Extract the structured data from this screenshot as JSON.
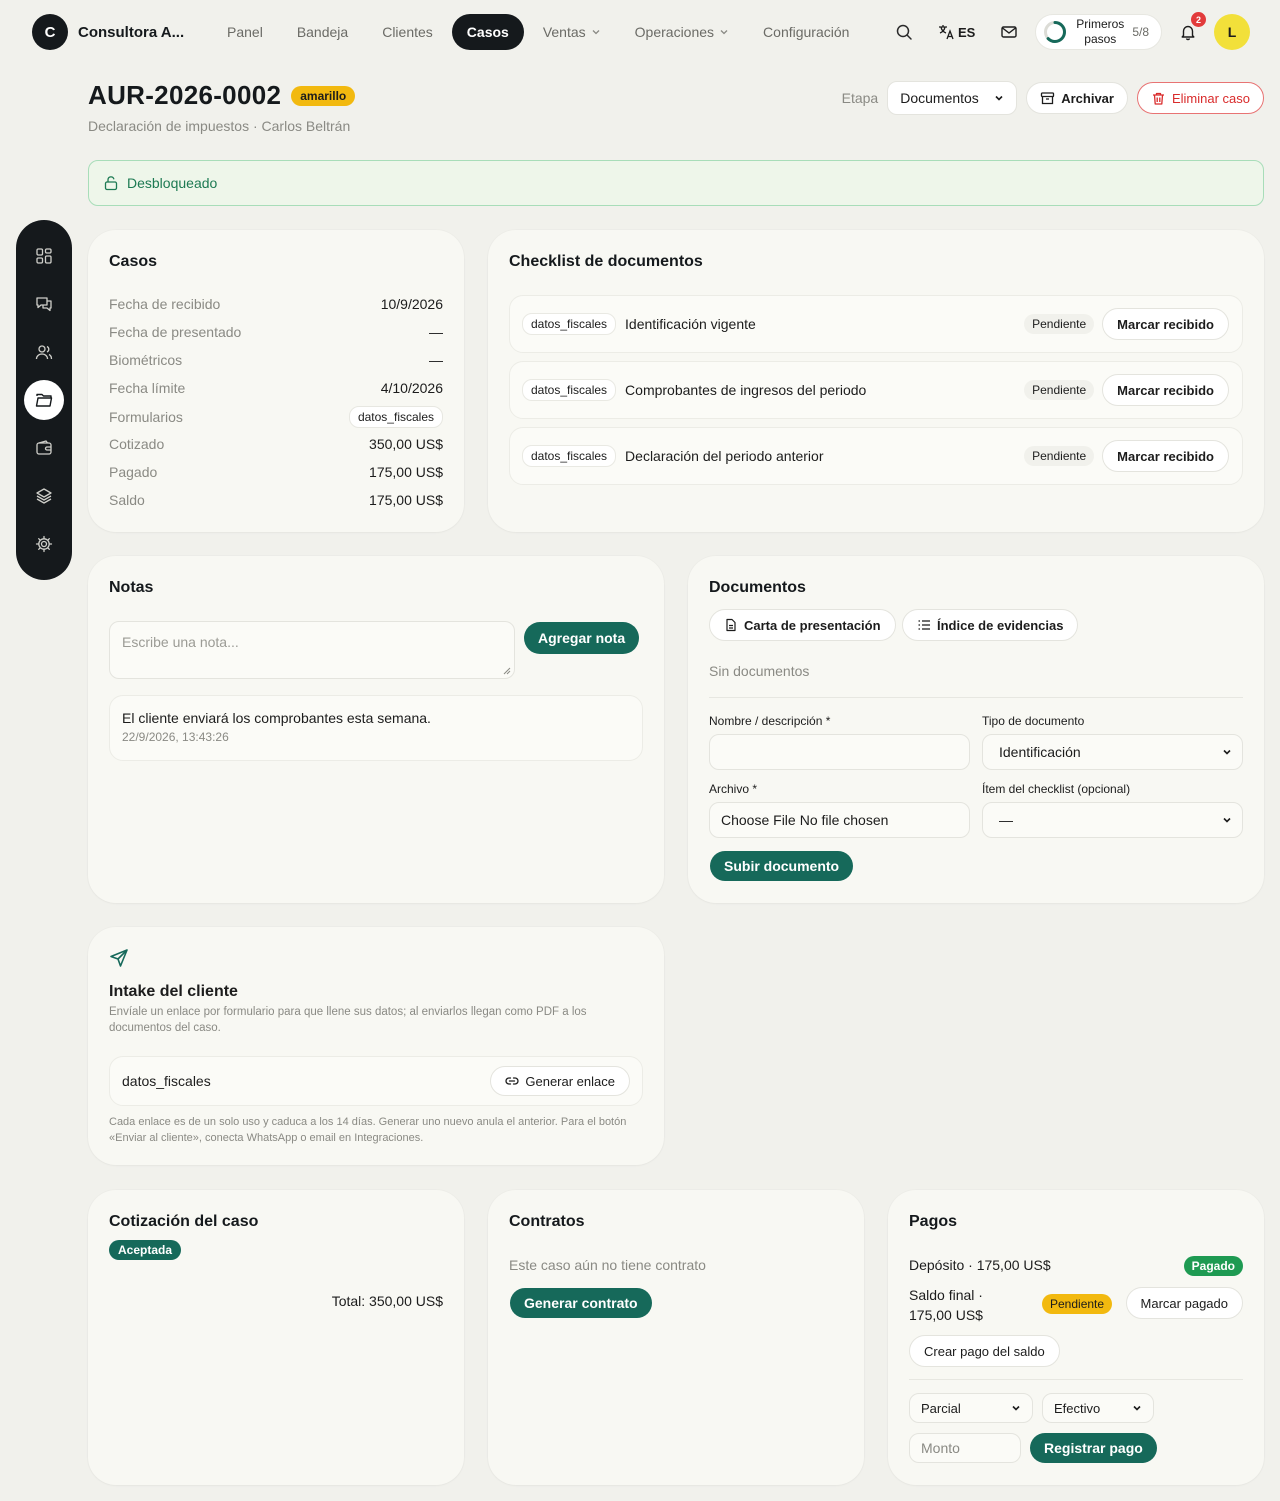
{
  "colors": {
    "accent": "#16695a",
    "dark": "#15191c",
    "danger": "#d92b2b",
    "unlocked": "#1d7a53",
    "tag_yellow": "#f2b90f",
    "paid": "#1e9a52"
  },
  "nav": {
    "brand_initial": "C",
    "brand_name": "Consultora A...",
    "links": [
      {
        "label": "Panel"
      },
      {
        "label": "Bandeja"
      },
      {
        "label": "Clientes"
      },
      {
        "label": "Casos",
        "active": true
      },
      {
        "label": "Ventas",
        "has_menu": true
      },
      {
        "label": "Operaciones",
        "has_menu": true
      },
      {
        "label": "Configuración"
      }
    ],
    "language": "ES",
    "onboarding_label_1": "Primeros",
    "onboarding_label_2": "pasos",
    "onboarding_count": "5/8",
    "onboarding_progress": 0.625,
    "notifications": "2",
    "avatar_initial": "L"
  },
  "rail": {
    "items": [
      "grid-icon",
      "chat-icon",
      "users-icon",
      "folder-icon",
      "wallet-icon",
      "layers-icon",
      "settings-icon"
    ],
    "active_index": 3
  },
  "header": {
    "case_id": "AUR-2026-0002",
    "color_tag": "amarillo",
    "subtitle": "Declaración de impuestos · Carlos Beltrán",
    "stage_label": "Etapa",
    "stage_value": "Documentos",
    "archive_label": "Archivar",
    "delete_label": "Eliminar caso"
  },
  "lock_status": "Desbloqueado",
  "casos": {
    "title": "Casos",
    "rows": [
      {
        "k": "Fecha de recibido",
        "v": "10/9/2026"
      },
      {
        "k": "Fecha de presentado",
        "v": "—"
      },
      {
        "k": "Biométricos",
        "v": "—"
      },
      {
        "k": "Fecha límite",
        "v": "4/10/2026"
      },
      {
        "k": "Formularios",
        "v": "datos_fiscales",
        "chip": true
      },
      {
        "k": "Cotizado",
        "v": "350,00 US$"
      },
      {
        "k": "Pagado",
        "v": "175,00 US$"
      },
      {
        "k": "Saldo",
        "v": "175,00 US$"
      }
    ]
  },
  "checklist": {
    "title": "Checklist de documentos",
    "items": [
      {
        "tag": "datos_fiscales",
        "doc": "Identificación vigente",
        "status": "Pendiente",
        "action": "Marcar recibido"
      },
      {
        "tag": "datos_fiscales",
        "doc": "Comprobantes de ingresos del periodo",
        "status": "Pendiente",
        "action": "Marcar recibido"
      },
      {
        "tag": "datos_fiscales",
        "doc": "Declaración del periodo anterior",
        "status": "Pendiente",
        "action": "Marcar recibido"
      }
    ]
  },
  "notes": {
    "title": "Notas",
    "placeholder": "Escribe una nota...",
    "add_label": "Agregar nota",
    "items": [
      {
        "text": "El cliente enviará los comprobantes esta semana.",
        "date": "22/9/2026, 13:43:26"
      }
    ]
  },
  "documents": {
    "title": "Documentos",
    "cover_letter": "Carta de presentación",
    "evidence_index": "Índice de evidencias",
    "empty": "Sin documentos",
    "name_label": "Nombre / descripción *",
    "type_label": "Tipo de documento",
    "type_value": "Identificación",
    "file_label": "Archivo *",
    "file_button": "Choose File",
    "file_status": "No file chosen",
    "checklist_label": "Ítem del checklist (opcional)",
    "checklist_value": "—",
    "upload_label": "Subir documento"
  },
  "intake": {
    "title": "Intake del cliente",
    "description": "Envíale un enlace por formulario para que llene sus datos; al enviarlos llegan como PDF a los documentos del caso.",
    "form_name": "datos_fiscales",
    "generate_label": "Generar enlace",
    "footnote": "Cada enlace es de un solo uso y caduca a los 14 días. Generar uno nuevo anula el anterior. Para el botón «Enviar al cliente», conecta WhatsApp o email en Integraciones."
  },
  "quote": {
    "title": "Cotización del caso",
    "status": "Aceptada",
    "total": "Total: 350,00 US$"
  },
  "contracts": {
    "title": "Contratos",
    "empty": "Este caso aún no tiene contrato",
    "generate_label": "Generar contrato"
  },
  "payments": {
    "title": "Pagos",
    "deposit": "Depósito · 175,00 US$",
    "deposit_status": "Pagado",
    "final_line1": "Saldo final ·",
    "final_line2": "175,00 US$",
    "final_status": "Pendiente",
    "mark_paid": "Marcar pagado",
    "create_balance": "Crear pago del saldo",
    "type_value": "Parcial",
    "method_value": "Efectivo",
    "amount_placeholder": "Monto",
    "register_label": "Registrar pago"
  }
}
